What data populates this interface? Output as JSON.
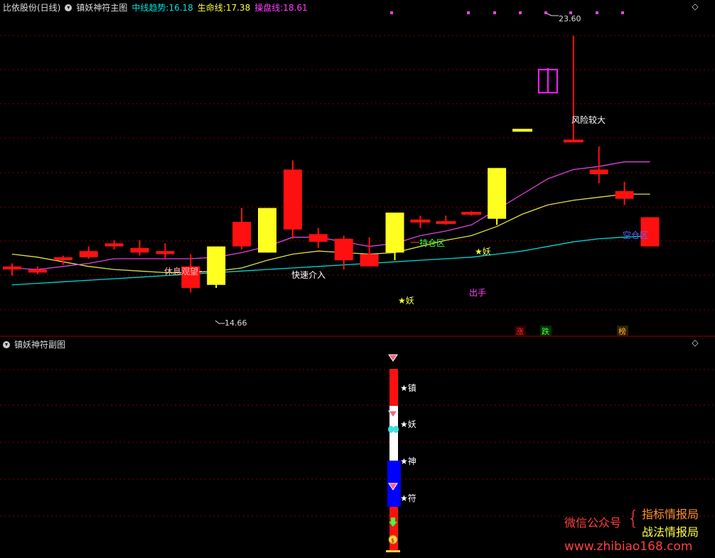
{
  "main_panel": {
    "stock": "比依股份(日线)",
    "indicator": "镇妖神符主图",
    "legend": [
      {
        "label": "中线趋势:",
        "value": "16.18",
        "color": "#00e0e0"
      },
      {
        "label": "生命线:",
        "value": "17.38",
        "color": "#ffff40"
      },
      {
        "label": "操盘线:",
        "value": "18.61",
        "color": "#ff40ff"
      }
    ],
    "price_high_label": "23.60",
    "price_low_label": "14.66",
    "annotations": {
      "rest": "休息观望~",
      "quick": "快速介入",
      "hold": "持仓区",
      "yao1": "★妖",
      "yao2": "★妖",
      "out": "出手",
      "risk": "风险较大",
      "empty": "空仓区"
    },
    "bottom_tags": {
      "zhang": "涨",
      "die": "跌",
      "bang": "榜"
    }
  },
  "sub_panel": {
    "title": "镇妖神符副图",
    "labels": [
      "★镇",
      "★妖",
      "★神",
      "★符"
    ]
  },
  "watermark": {
    "left": "微信公众号",
    "right1": "指标情报局",
    "right2": "战法情报局",
    "url": "www.zhibiao168.com"
  },
  "colors": {
    "up": "#ff1010",
    "yellow": "#ffff20",
    "mid_trend": "#00d8d8",
    "life": "#e0e040",
    "operate": "#e040e0",
    "grid": "#800000"
  },
  "chart_data": {
    "type": "candlestick",
    "y_range": [
      13.9,
      24.3
    ],
    "candles": [
      {
        "o": 16.0,
        "h": 16.2,
        "l": 15.8,
        "c": 16.1,
        "color": "red",
        "fill": true
      },
      {
        "o": 15.9,
        "h": 16.1,
        "l": 15.85,
        "c": 16.0,
        "color": "red",
        "fill": true
      },
      {
        "o": 16.3,
        "h": 16.45,
        "l": 16.15,
        "c": 16.4,
        "color": "red",
        "fill": true
      },
      {
        "o": 16.4,
        "h": 16.75,
        "l": 16.35,
        "c": 16.6,
        "color": "red",
        "fill": true
      },
      {
        "o": 16.75,
        "h": 16.95,
        "l": 16.65,
        "c": 16.85,
        "color": "red",
        "fill": true
      },
      {
        "o": 16.55,
        "h": 16.95,
        "l": 16.45,
        "c": 16.7,
        "color": "red",
        "fill": true
      },
      {
        "o": 16.5,
        "h": 16.85,
        "l": 16.35,
        "c": 16.6,
        "color": "red",
        "fill": true
      },
      {
        "o": 15.4,
        "h": 16.5,
        "l": 15.25,
        "c": 16.1,
        "color": "red",
        "fill": true
      },
      {
        "o": 15.5,
        "h": 16.7,
        "l": 15.4,
        "c": 16.75,
        "color": "yellow",
        "fill": true
      },
      {
        "o": 16.75,
        "h": 18.0,
        "l": 16.65,
        "c": 17.55,
        "color": "red",
        "fill": true
      },
      {
        "o": 16.55,
        "h": 18.0,
        "l": 16.55,
        "c": 18.0,
        "color": "yellow",
        "fill": true
      },
      {
        "o": 17.3,
        "h": 19.55,
        "l": 17.0,
        "c": 19.25,
        "color": "red",
        "fill": true
      },
      {
        "o": 16.9,
        "h": 17.35,
        "l": 16.7,
        "c": 17.15,
        "color": "red",
        "fill": true
      },
      {
        "o": 16.3,
        "h": 17.1,
        "l": 16.0,
        "c": 17.0,
        "color": "red",
        "fill": true
      },
      {
        "o": 16.1,
        "h": 17.05,
        "l": 16.1,
        "c": 16.5,
        "color": "red",
        "fill": true
      },
      {
        "o": 16.55,
        "h": 17.8,
        "l": 16.3,
        "c": 17.85,
        "color": "yellow",
        "fill": true
      },
      {
        "o": 17.55,
        "h": 17.75,
        "l": 17.35,
        "c": 17.6,
        "color": "red",
        "fill": false
      },
      {
        "o": 17.55,
        "h": 17.75,
        "l": 17.45,
        "c": 17.55,
        "color": "red",
        "fill": false
      },
      {
        "o": 17.85,
        "h": 17.9,
        "l": 17.75,
        "c": 17.85,
        "color": "red",
        "fill": false
      },
      {
        "o": 17.65,
        "h": 19.3,
        "l": 17.45,
        "c": 19.3,
        "color": "yellow",
        "fill": true
      },
      {
        "o": 20.55,
        "h": 20.55,
        "l": 20.55,
        "c": 20.55,
        "color": "yellow",
        "fill": false
      },
      {
        "o": 22.5,
        "h": 22.55,
        "l": 21.75,
        "c": 21.75,
        "color": "magenta",
        "fill": false
      },
      {
        "o": 20.2,
        "h": 23.6,
        "l": 20.2,
        "c": 20.2,
        "color": "red",
        "fill": false
      },
      {
        "o": 19.25,
        "h": 20.0,
        "l": 18.8,
        "c": 19.1,
        "color": "red",
        "fill": true
      },
      {
        "o": 18.3,
        "h": 18.85,
        "l": 18.1,
        "c": 18.55,
        "color": "red",
        "fill": true
      },
      {
        "o": 16.75,
        "h": 17.7,
        "l": 16.75,
        "c": 17.7,
        "color": "red",
        "fill": true
      }
    ],
    "mid_trend": [
      15.5,
      15.55,
      15.6,
      15.65,
      15.7,
      15.75,
      15.8,
      15.85,
      15.9,
      15.95,
      16.0,
      16.05,
      16.1,
      16.15,
      16.2,
      16.25,
      16.3,
      16.35,
      16.4,
      16.5,
      16.6,
      16.75,
      16.9,
      17.0,
      17.05,
      17.1
    ],
    "life_line": [
      16.5,
      16.4,
      16.25,
      16.1,
      16.0,
      15.95,
      15.9,
      15.9,
      15.95,
      16.05,
      16.3,
      16.5,
      16.6,
      16.55,
      16.5,
      16.55,
      16.75,
      16.95,
      17.1,
      17.4,
      17.8,
      18.1,
      18.25,
      18.35,
      18.45,
      18.45
    ],
    "operate_line": [
      16.05,
      16.0,
      16.1,
      16.2,
      16.35,
      16.35,
      16.35,
      16.35,
      16.4,
      16.55,
      16.75,
      17.05,
      17.05,
      16.9,
      16.75,
      16.85,
      17.1,
      17.25,
      17.45,
      17.95,
      18.45,
      18.95,
      19.25,
      19.35,
      19.5,
      19.5
    ]
  }
}
